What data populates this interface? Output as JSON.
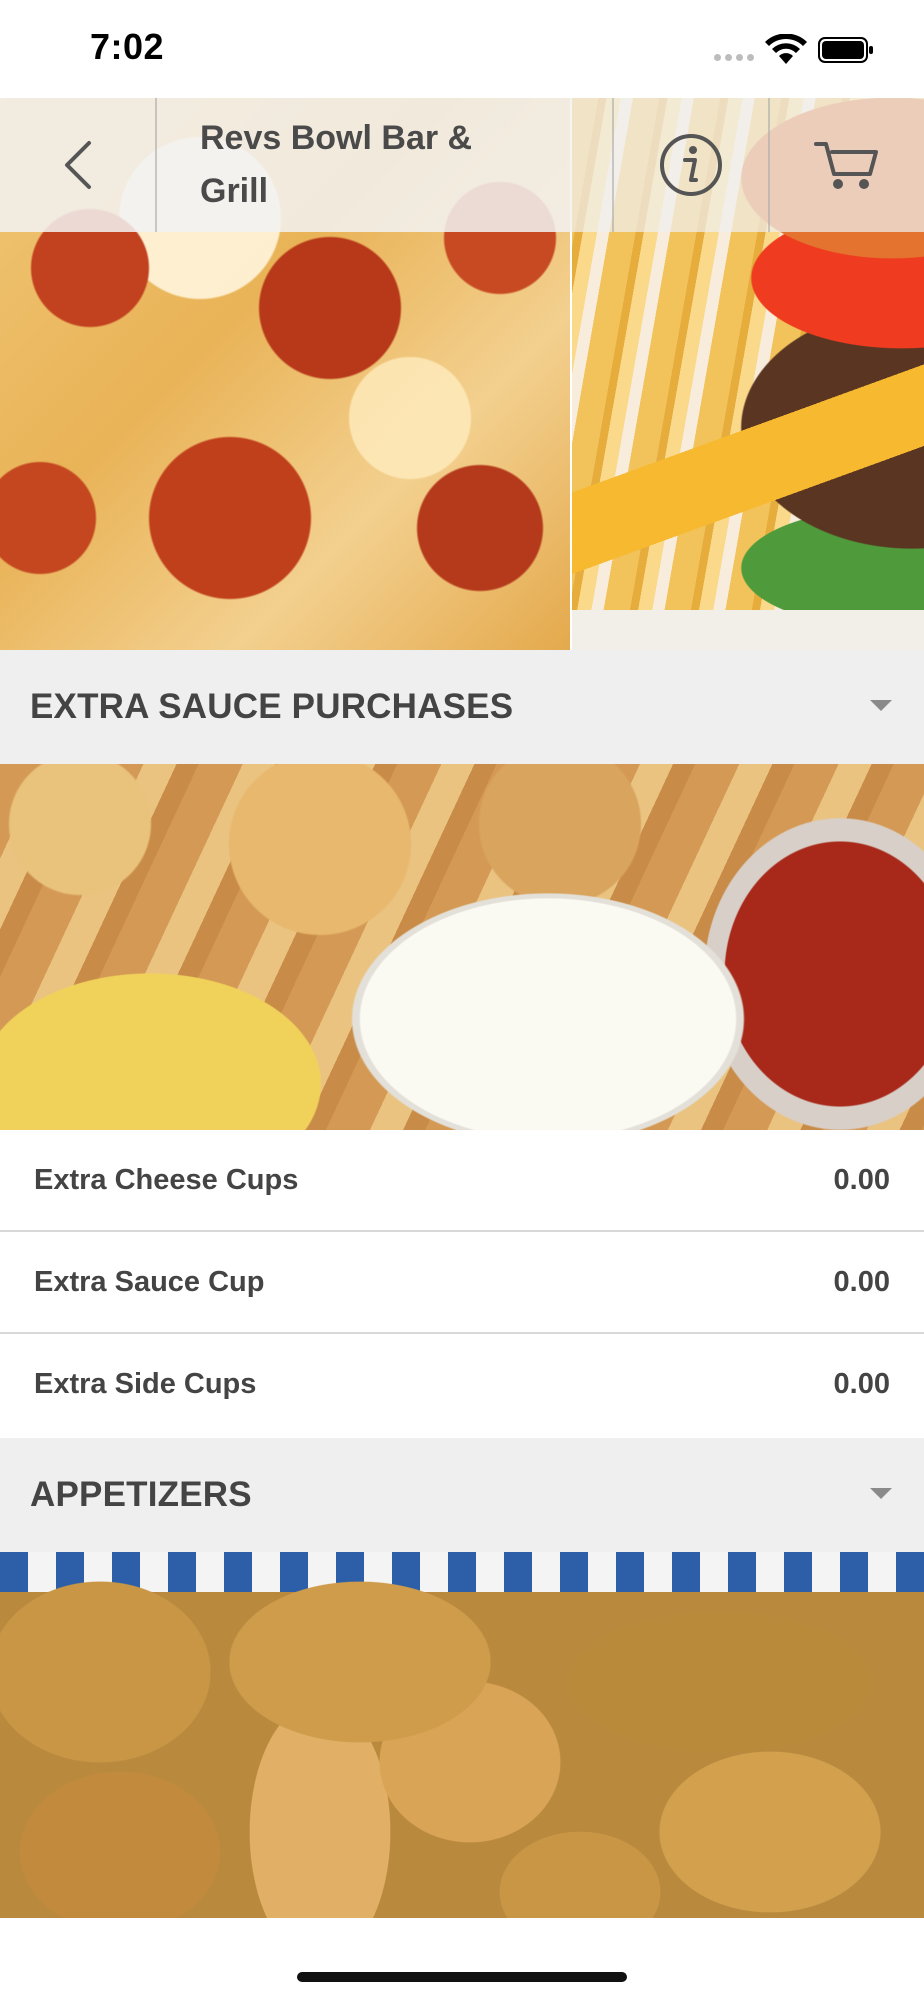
{
  "status_bar": {
    "time": "7:02"
  },
  "header": {
    "title": "Revs Bowl Bar & Grill"
  },
  "sections": [
    {
      "title": "EXTRA SAUCE PURCHASES",
      "items": [
        {
          "name": "Extra Cheese Cups",
          "price": "0.00"
        },
        {
          "name": "Extra Sauce Cup",
          "price": "0.00"
        },
        {
          "name": "Extra Side Cups",
          "price": "0.00"
        }
      ]
    },
    {
      "title": "APPETIZERS"
    }
  ],
  "icons": {
    "back": "chevron-left-icon",
    "info": "info-circle-icon",
    "cart": "shopping-cart-icon",
    "section_toggle": "caret-down-icon"
  },
  "colors": {
    "section_header_bg": "#efefef",
    "text": "#444444",
    "divider": "#d8d8d8"
  }
}
